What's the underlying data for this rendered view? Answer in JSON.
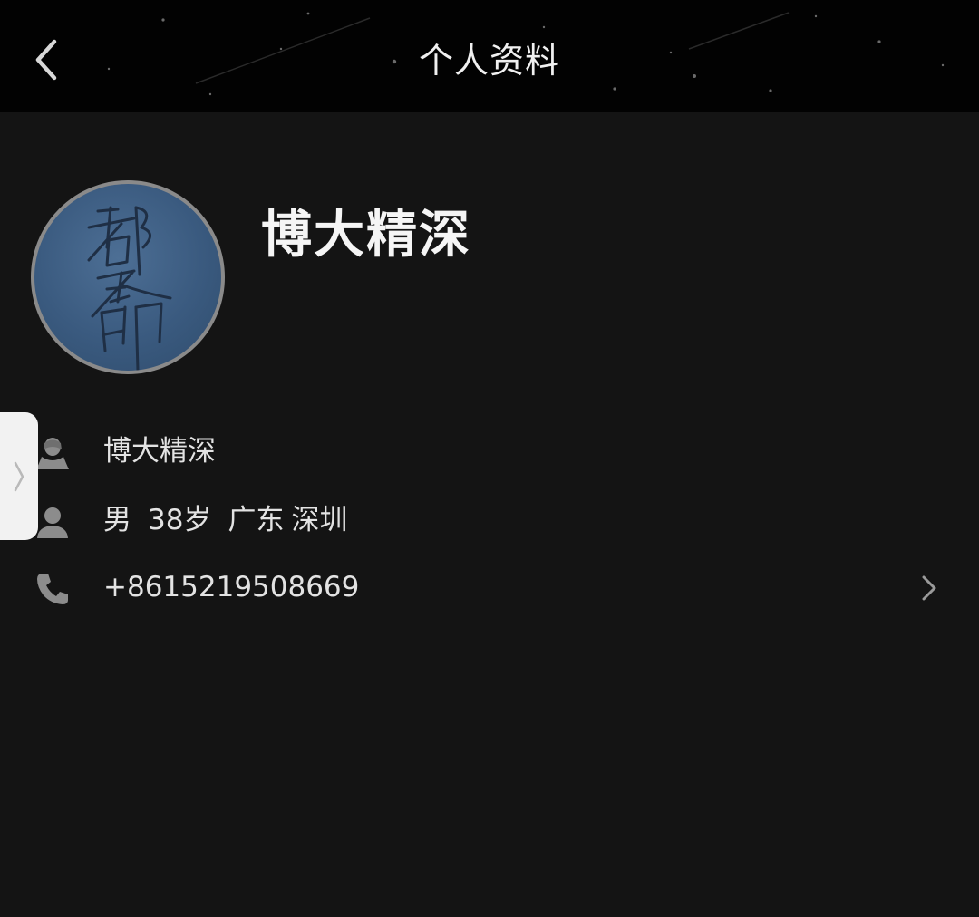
{
  "header": {
    "title": "个人资料",
    "back_icon": "chevron-left-icon"
  },
  "profile": {
    "display_name": "博大精深",
    "avatar": {
      "description_icon": "avatar-calligraphy-image",
      "background_color": "#3f6188"
    }
  },
  "info": {
    "nickname": {
      "icon": "person-silhouette-icon",
      "value": "博大精深"
    },
    "basic": {
      "icon": "user-icon",
      "gender": "男",
      "age": "38岁",
      "province": "广东",
      "city": "深圳"
    },
    "phone": {
      "icon": "phone-icon",
      "value": "+8615219508669",
      "chevron_icon": "chevron-right-icon"
    }
  },
  "side_handle": {
    "icon": "chevron-right-icon"
  },
  "colors": {
    "header_bg": "#020202",
    "page_bg": "#141414",
    "text_primary": "#f5f5f5",
    "text_secondary": "#e3e3e3",
    "icon_gray": "#8c8c8c"
  }
}
